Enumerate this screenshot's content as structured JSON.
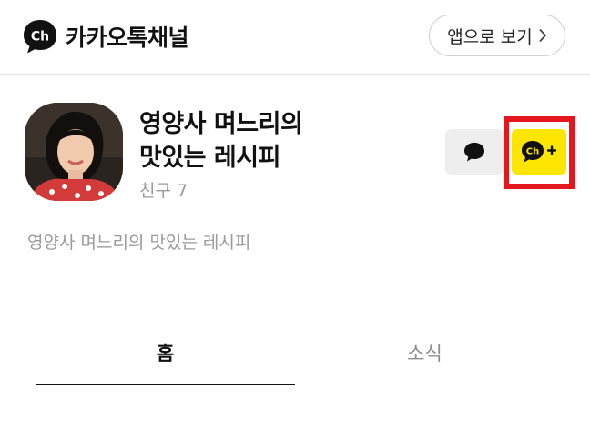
{
  "header": {
    "brand": "카카오톡채널",
    "logo_text": "Ch",
    "open_app_label": "앱으로 보기"
  },
  "profile": {
    "title_line1": "영양사 며느리의",
    "title_line2": "맛있는 레시피",
    "friends": "친구 7",
    "description": "영양사 며느리의 맛있는 레시피"
  },
  "actions": {
    "add_channel_icon_text": "Ch+"
  },
  "tabs": [
    {
      "label": "홈",
      "selected": true
    },
    {
      "label": "소식",
      "selected": false
    }
  ],
  "colors": {
    "accent_yellow": "#fee500",
    "highlight_red": "#e3171d",
    "muted_text": "#9a9a9a"
  }
}
